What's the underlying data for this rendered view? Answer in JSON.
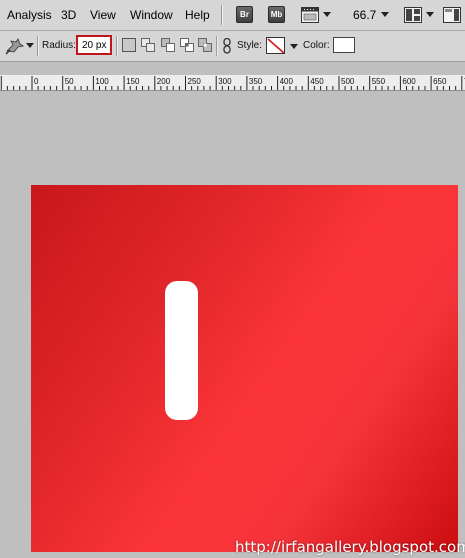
{
  "menubar": {
    "items": [
      "Analysis",
      "3D",
      "View",
      "Window",
      "Help"
    ],
    "bridge_badge": "Br",
    "minibridge_badge": "Mb",
    "zoom": "66.7"
  },
  "options": {
    "radius_label": "Radius:",
    "radius_value": "20 px",
    "style_label": "Style:",
    "color_label": "Color:",
    "color_value": "#ffffff"
  },
  "ruler": {
    "labels": [
      "0",
      "50",
      "100",
      "150",
      "200",
      "250",
      "300",
      "350",
      "400",
      "450",
      "500",
      "550",
      "600",
      "650",
      "700"
    ]
  },
  "canvas": {
    "gradient_colors": [
      "#c8171b",
      "#fb3537",
      "#cb0d10"
    ],
    "shape_color": "#ffffff"
  },
  "watermark": "http://irfangallery.blogspot.com"
}
